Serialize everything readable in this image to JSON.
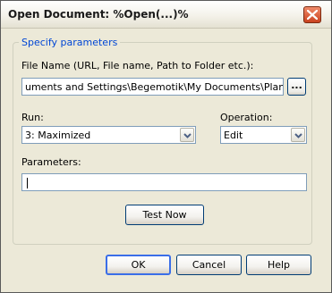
{
  "window": {
    "title": "Open Document: %Open(...)%"
  },
  "group": {
    "legend": "Specify parameters"
  },
  "file_name": {
    "label": "File Name (URL, File name, Path to Folder etc.):",
    "value": "uments and Settings\\Begemotik\\My Documents\\Plans.doc",
    "browse_label": "..."
  },
  "run": {
    "label": "Run:",
    "value": "3: Maximized"
  },
  "operation": {
    "label": "Operation:",
    "value": "Edit"
  },
  "parameters": {
    "label": "Parameters:",
    "value": ""
  },
  "buttons": {
    "test_now": "Test Now",
    "ok": "OK",
    "cancel": "Cancel",
    "help": "Help"
  },
  "icons": {
    "close": "close-x-icon",
    "dropdown": "chevron-down-icon"
  },
  "colors": {
    "group_legend": "#0046d5",
    "close_button": "#c9421f",
    "dialog_background": "#ece9d8"
  }
}
